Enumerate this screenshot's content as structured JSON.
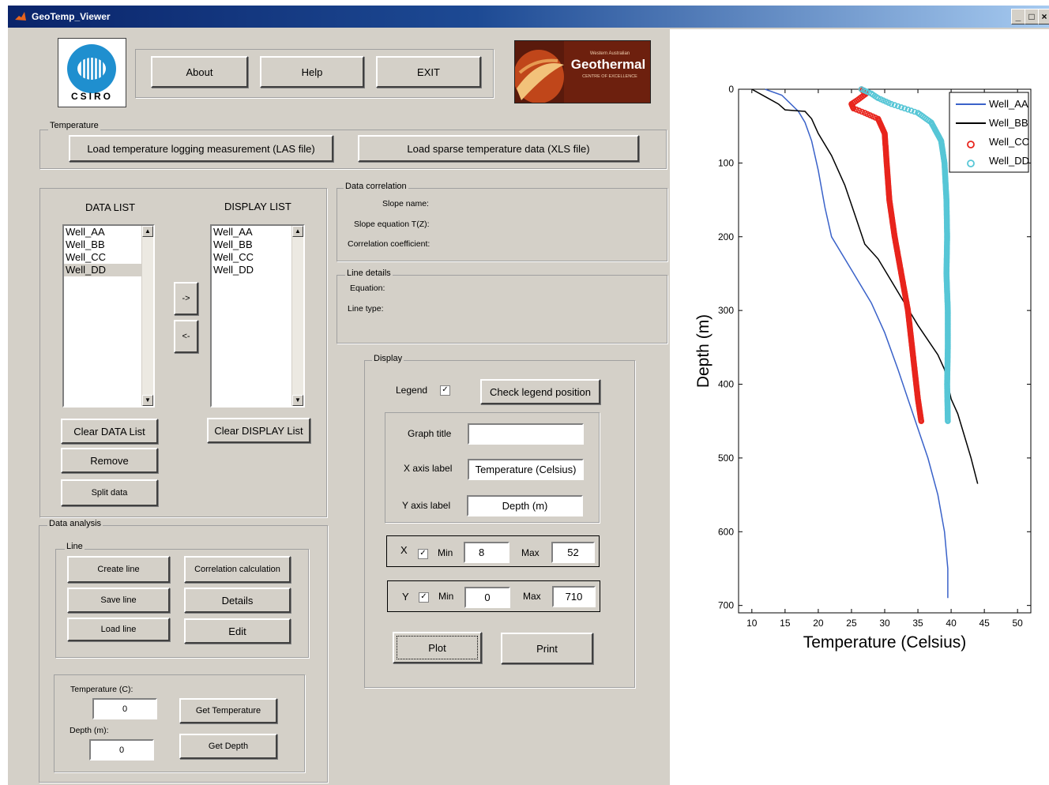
{
  "window": {
    "title": "GeoTemp_Viewer",
    "min": "_",
    "max": "□",
    "close": "×"
  },
  "logos": {
    "csiro": "CSIRO",
    "geothermal_top": "Western Australian",
    "geothermal_name": "Geothermal",
    "geothermal_sub": "CENTRE OF EXCELLENCE"
  },
  "toolbar": {
    "about": "About",
    "help": "Help",
    "exit": "EXIT"
  },
  "temperature": {
    "label": "Temperature",
    "load_las": "Load temperature logging measurement (LAS file)",
    "load_xls": "Load sparse temperature data (XLS file)"
  },
  "lists": {
    "data_title": "DATA LIST",
    "display_title": "DISPLAY LIST",
    "data_items": [
      "Well_AA",
      "Well_BB",
      "Well_CC",
      "Well_DD"
    ],
    "display_items": [
      "Well_AA",
      "Well_BB",
      "Well_CC",
      "Well_DD"
    ],
    "move_right": "->",
    "move_left": "<-",
    "clear_data": "Clear DATA List",
    "clear_display": "Clear DISPLAY List",
    "remove": "Remove",
    "split": "Split data"
  },
  "correlation": {
    "label": "Data correlation",
    "slope_name": "Slope name:",
    "slope_eq": "Slope equation T(Z):",
    "coeff": "Correlation coefficient:"
  },
  "line_details": {
    "label": "Line details",
    "equation": "Equation:",
    "line_type": "Line type:"
  },
  "display": {
    "label": "Display",
    "legend": "Legend",
    "legend_checked": "✓",
    "check_legend": "Check legend position",
    "graph_title_label": "Graph title",
    "graph_title_value": "",
    "x_label_label": "X axis label",
    "x_label_value": "Temperature (Celsius)",
    "y_label_label": "Y axis label",
    "y_label_value": "Depth (m)",
    "x": "X",
    "y": "Y",
    "min": "Min",
    "max": "Max",
    "check": "✓",
    "x_min": "8",
    "x_max": "52",
    "y_min": "0",
    "y_max": "710",
    "plot": "Plot",
    "print": "Print"
  },
  "analysis": {
    "label": "Data analysis",
    "line_label": "Line",
    "create_line": "Create line",
    "correlation_calc": "Correlation calculation",
    "save_line": "Save line",
    "details": "Details",
    "load_line": "Load line",
    "edit": "Edit",
    "temp_label": "Temperature (C):",
    "temp_value": "0",
    "get_temp": "Get Temperature",
    "depth_label": "Depth (m):",
    "depth_value": "0",
    "get_depth": "Get Depth"
  },
  "chart_data": {
    "type": "line",
    "xlabel": "Temperature (Celsius)",
    "ylabel": "Depth (m)",
    "xlim": [
      8,
      52
    ],
    "ylim": [
      0,
      710
    ],
    "y_inverted": true,
    "xticks": [
      10,
      15,
      20,
      25,
      30,
      35,
      40,
      45,
      50
    ],
    "yticks": [
      0,
      100,
      200,
      300,
      400,
      500,
      600,
      700
    ],
    "legend_position": "top-right",
    "series": [
      {
        "name": "Well_AA",
        "style": "line",
        "color": "#3a62c9",
        "points": [
          [
            12,
            0
          ],
          [
            14.5,
            8
          ],
          [
            17,
            30
          ],
          [
            18,
            45
          ],
          [
            19,
            70
          ],
          [
            20,
            110
          ],
          [
            21,
            160
          ],
          [
            22,
            200
          ],
          [
            25,
            245
          ],
          [
            28,
            290
          ],
          [
            30,
            330
          ],
          [
            32,
            380
          ],
          [
            33.5,
            420
          ],
          [
            35,
            460
          ],
          [
            36.5,
            500
          ],
          [
            38,
            550
          ],
          [
            39,
            600
          ],
          [
            39.5,
            650
          ],
          [
            39.5,
            690
          ]
        ]
      },
      {
        "name": "Well_BB",
        "style": "line",
        "color": "#000000",
        "points": [
          [
            10,
            0
          ],
          [
            12,
            10
          ],
          [
            14,
            20
          ],
          [
            15,
            28
          ],
          [
            18,
            30
          ],
          [
            19,
            40
          ],
          [
            20,
            60
          ],
          [
            22,
            90
          ],
          [
            24,
            130
          ],
          [
            25.5,
            170
          ],
          [
            27,
            210
          ],
          [
            29,
            230
          ],
          [
            31,
            260
          ],
          [
            33,
            290
          ],
          [
            35,
            320
          ],
          [
            38,
            360
          ],
          [
            39,
            380
          ],
          [
            39.5,
            400
          ],
          [
            40,
            420
          ],
          [
            41,
            440
          ],
          [
            42,
            470
          ],
          [
            43,
            500
          ],
          [
            44,
            535
          ]
        ]
      },
      {
        "name": "Well_CC",
        "style": "scatter",
        "color": "#e8241c",
        "points": [
          [
            26.5,
            0
          ],
          [
            27.2,
            6
          ],
          [
            26.0,
            14
          ],
          [
            25.0,
            20
          ],
          [
            25.3,
            26
          ],
          [
            27.0,
            32
          ],
          [
            29.0,
            40
          ],
          [
            30.0,
            60
          ],
          [
            30.3,
            100
          ],
          [
            30.7,
            150
          ],
          [
            31.5,
            200
          ],
          [
            32.5,
            250
          ],
          [
            33.5,
            300
          ],
          [
            34.0,
            340
          ],
          [
            34.5,
            380
          ],
          [
            35.0,
            420
          ],
          [
            35.5,
            450
          ]
        ]
      },
      {
        "name": "Well_DD",
        "style": "scatter",
        "color": "#56c6d6",
        "points": [
          [
            26.5,
            0
          ],
          [
            28.0,
            6
          ],
          [
            29.0,
            12
          ],
          [
            31.0,
            20
          ],
          [
            33.0,
            26
          ],
          [
            35.0,
            32
          ],
          [
            37.0,
            45
          ],
          [
            38.5,
            70
          ],
          [
            39.0,
            100
          ],
          [
            39.3,
            150
          ],
          [
            39.4,
            200
          ],
          [
            39.3,
            250
          ],
          [
            39.5,
            300
          ],
          [
            39.5,
            350
          ],
          [
            39.4,
            400
          ],
          [
            39.5,
            450
          ]
        ]
      }
    ]
  }
}
